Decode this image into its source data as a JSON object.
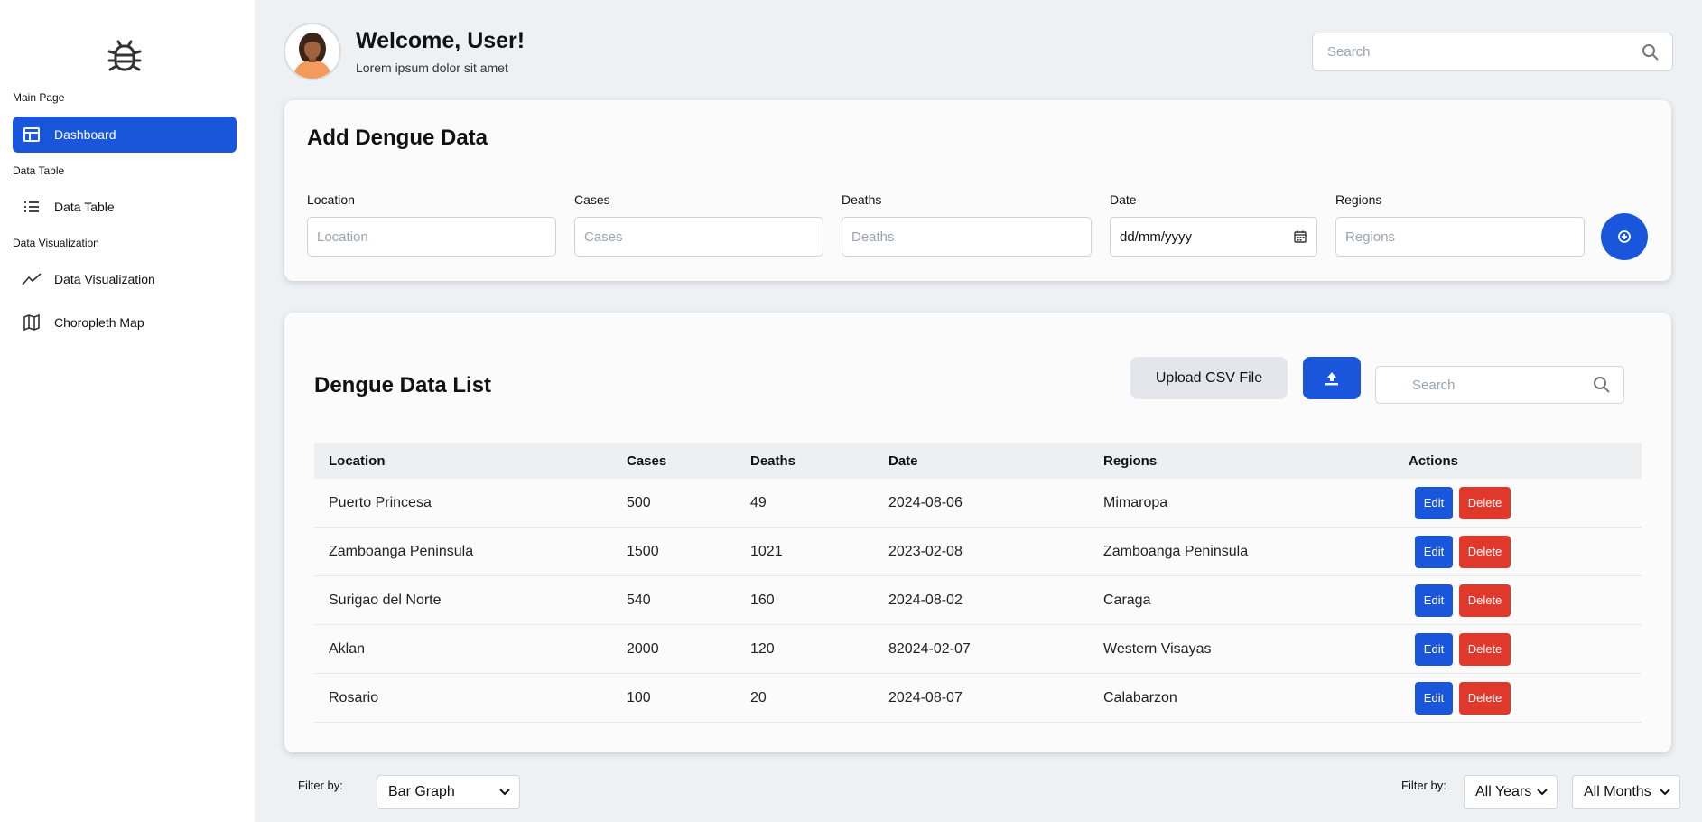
{
  "sidebar": {
    "sections": {
      "main": "Main Page",
      "table": "Data Table",
      "viz": "Data Visualization"
    },
    "items": [
      {
        "label": "Dashboard",
        "icon": "dashboard-icon",
        "active": true
      },
      {
        "label": "Data Table",
        "icon": "list-icon"
      },
      {
        "label": "Data Visualization",
        "icon": "line-chart-icon"
      },
      {
        "label": "Choropleth Map",
        "icon": "map-icon"
      }
    ]
  },
  "header": {
    "welcome": "Welcome, User!",
    "subtitle": "Lorem ipsum dolor sit amet",
    "search_placeholder": "Search"
  },
  "add_form": {
    "title": "Add Dengue Data",
    "fields": {
      "location": {
        "label": "Location",
        "placeholder": "Location"
      },
      "cases": {
        "label": "Cases",
        "placeholder": "Cases"
      },
      "deaths": {
        "label": "Deaths",
        "placeholder": "Deaths"
      },
      "date": {
        "label": "Date",
        "value": "dd/mm/yyyy"
      },
      "regions": {
        "label": "Regions",
        "placeholder": "Regions"
      }
    }
  },
  "list": {
    "title": "Dengue Data List",
    "upload_label": "Upload CSV File",
    "search_placeholder": "Search",
    "columns": [
      "Location",
      "Cases",
      "Deaths",
      "Date",
      "Regions",
      "Actions"
    ],
    "edit_label": "Edit",
    "delete_label": "Delete",
    "rows": [
      {
        "location": "Puerto Princesa",
        "cases": "500",
        "deaths": "49",
        "date": "2024-08-06",
        "region": "Mimaropa"
      },
      {
        "location": "Zamboanga Peninsula",
        "cases": "1500",
        "deaths": "1021",
        "date": "2023-02-08",
        "region": "Zamboanga Peninsula"
      },
      {
        "location": "Surigao del Norte",
        "cases": "540",
        "deaths": "160",
        "date": "2024-08-02",
        "region": "Caraga"
      },
      {
        "location": "Aklan",
        "cases": "2000",
        "deaths": "120",
        "date": "82024-02-07",
        "region": "Western Visayas"
      },
      {
        "location": "Rosario",
        "cases": "100",
        "deaths": "20",
        "date": "2024-08-07",
        "region": "Calabarzon"
      }
    ]
  },
  "filters": {
    "left_label": "Filter by:",
    "chart_type": "Bar Graph",
    "right_label": "Filter by:",
    "years": "All Years",
    "months": "All Months"
  },
  "colors": {
    "primary": "#1a56db",
    "danger": "#e0382b",
    "background": "#eef1f4"
  }
}
